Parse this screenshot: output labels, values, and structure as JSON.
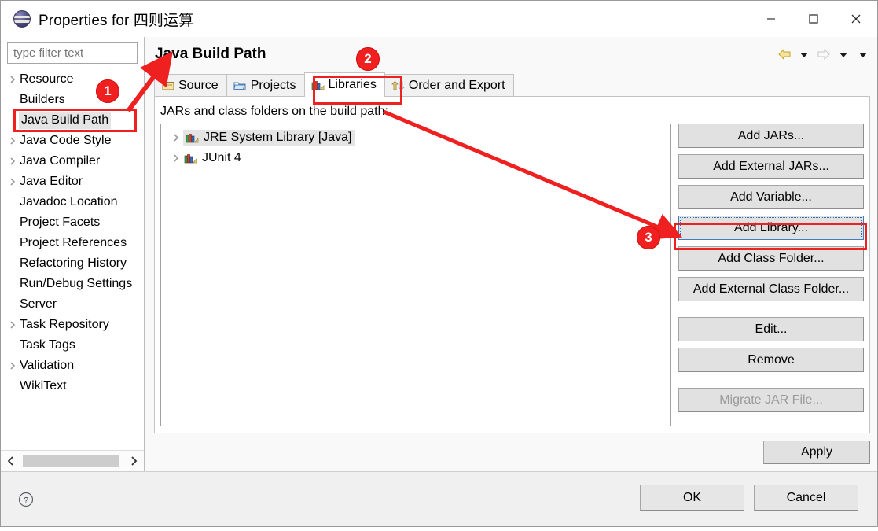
{
  "window": {
    "title": "Properties for 四则运算",
    "icon": "eclipse-sphere-icon",
    "controls": {
      "minimize": "minimize-icon",
      "maximize": "maximize-icon",
      "close": "close-icon"
    }
  },
  "sidebar": {
    "filter": {
      "placeholder": "type filter text",
      "value": ""
    },
    "items": [
      {
        "label": "Resource",
        "expandable": true,
        "selected": false
      },
      {
        "label": "Builders",
        "expandable": false,
        "selected": false
      },
      {
        "label": "Java Build Path",
        "expandable": false,
        "selected": true
      },
      {
        "label": "Java Code Style",
        "expandable": true,
        "selected": false
      },
      {
        "label": "Java Compiler",
        "expandable": true,
        "selected": false
      },
      {
        "label": "Java Editor",
        "expandable": true,
        "selected": false
      },
      {
        "label": "Javadoc Location",
        "expandable": false,
        "selected": false
      },
      {
        "label": "Project Facets",
        "expandable": false,
        "selected": false
      },
      {
        "label": "Project References",
        "expandable": false,
        "selected": false
      },
      {
        "label": "Refactoring History",
        "expandable": false,
        "selected": false
      },
      {
        "label": "Run/Debug Settings",
        "expandable": false,
        "selected": false
      },
      {
        "label": "Server",
        "expandable": false,
        "selected": false
      },
      {
        "label": "Task Repository",
        "expandable": true,
        "selected": false
      },
      {
        "label": "Task Tags",
        "expandable": false,
        "selected": false
      },
      {
        "label": "Validation",
        "expandable": true,
        "selected": false
      },
      {
        "label": "WikiText",
        "expandable": false,
        "selected": false
      }
    ],
    "scroll": {
      "left_arrow": "chevron-left-icon",
      "right_arrow": "chevron-right-icon"
    }
  },
  "page": {
    "title": "Java Build Path",
    "nav": {
      "back": "back-arrow-icon",
      "back_menu": "chevron-down-icon",
      "forward": "forward-arrow-icon",
      "forward_menu": "chevron-down-icon",
      "view_menu": "chevron-down-icon"
    },
    "tabs": [
      {
        "label": "Source",
        "icon": "source-package-icon",
        "active": false
      },
      {
        "label": "Projects",
        "icon": "projects-folder-icon",
        "active": false
      },
      {
        "label": "Libraries",
        "icon": "libraries-books-icon",
        "active": true
      },
      {
        "label": "Order and Export",
        "icon": "order-export-icon",
        "active": false
      }
    ],
    "caption": "JARs and class folders on the build path:",
    "libraries": [
      {
        "label": "JRE System Library [Java]",
        "icon": "library-books-icon",
        "expandable": true,
        "selected": true
      },
      {
        "label": "JUnit 4",
        "icon": "library-books-icon",
        "expandable": true,
        "selected": false
      }
    ],
    "buttons": [
      {
        "label": "Add JARs...",
        "mnemonic": "J",
        "disabled": false,
        "focused": false
      },
      {
        "label": "Add External JARs...",
        "mnemonic": "x",
        "disabled": false,
        "focused": false
      },
      {
        "label": "Add Variable...",
        "mnemonic": "V",
        "disabled": false,
        "focused": false
      },
      {
        "label": "Add Library...",
        "mnemonic": "i",
        "disabled": false,
        "focused": true
      },
      {
        "label": "Add Class Folder...",
        "mnemonic": "C",
        "disabled": false,
        "focused": false
      },
      {
        "label": "Add External Class Folder...",
        "mnemonic": "d",
        "disabled": false,
        "focused": false
      },
      {
        "label": "Edit...",
        "mnemonic": "E",
        "disabled": false,
        "focused": false
      },
      {
        "label": "Remove",
        "mnemonic": "R",
        "disabled": false,
        "focused": false
      },
      {
        "label": "Migrate JAR File...",
        "mnemonic": "M",
        "disabled": true,
        "focused": false
      }
    ],
    "apply_label": "Apply"
  },
  "footer": {
    "help_icon": "help-question-icon",
    "ok_label": "OK",
    "cancel_label": "Cancel"
  },
  "annotations": {
    "badges": [
      {
        "text": "1",
        "target": "sidebar-item-java-build-path"
      },
      {
        "text": "2",
        "target": "tab-libraries"
      },
      {
        "text": "3",
        "target": "add-library-button"
      }
    ],
    "highlight_color": "#ef2020"
  }
}
